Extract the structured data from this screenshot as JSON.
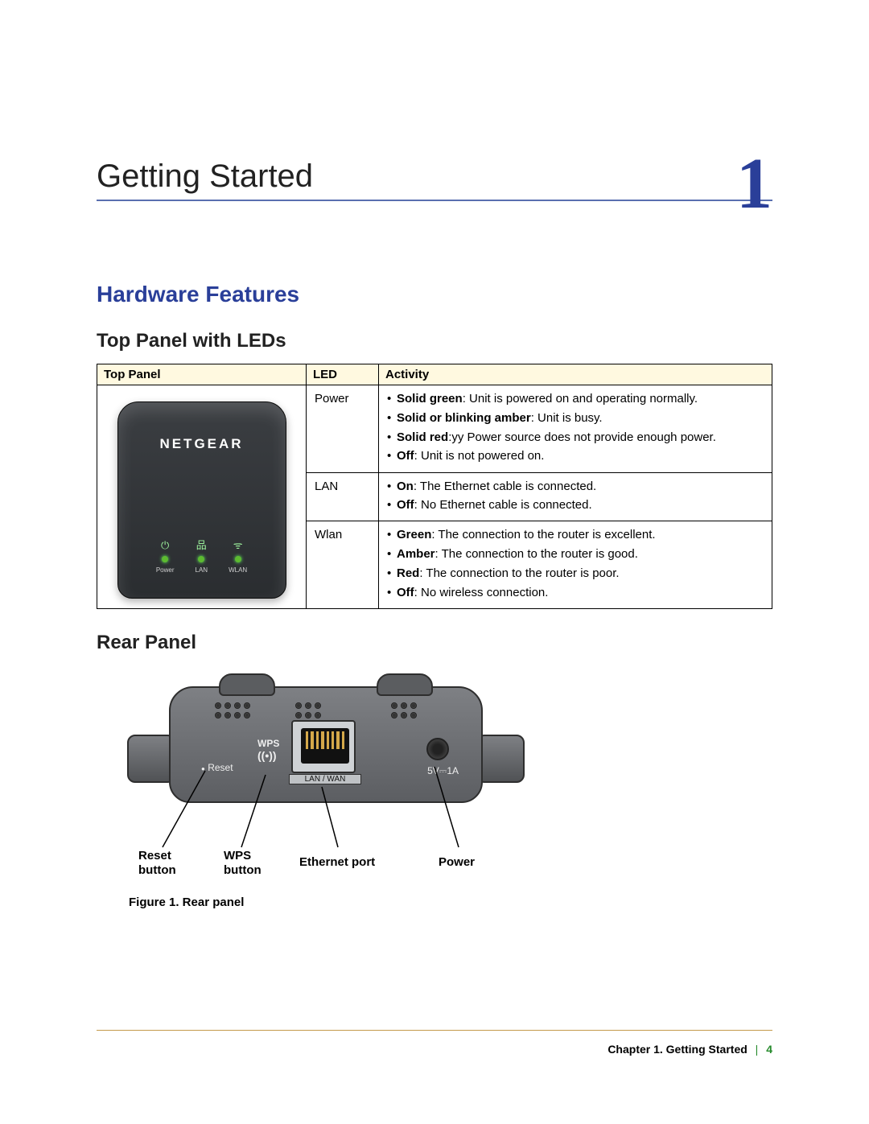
{
  "chapter": {
    "title": "Getting Started",
    "number": "1"
  },
  "section": "Hardware Features",
  "subsection_top": "Top Panel with LEDs",
  "subsection_rear": "Rear Panel",
  "table": {
    "headers": {
      "col1": "Top Panel",
      "col2": "LED",
      "col3": "Activity"
    },
    "brand": "NETGEAR",
    "led_labels": {
      "power": "Power",
      "lan": "LAN",
      "wlan": "WLAN"
    },
    "rows": [
      {
        "led": "Power",
        "items": [
          {
            "bold": "Solid green",
            "rest": ": Unit is powered on and operating normally."
          },
          {
            "bold": "Solid or blinking amber",
            "rest": ": Unit is busy."
          },
          {
            "bold": "Solid red",
            "rest": ":yy Power source does not provide enough power."
          },
          {
            "bold": "Off",
            "rest": ": Unit is not powered on."
          }
        ]
      },
      {
        "led": "LAN",
        "items": [
          {
            "bold": "On",
            "rest": ": The Ethernet cable is connected."
          },
          {
            "bold": "Off",
            "rest": ": No Ethernet cable is connected."
          }
        ]
      },
      {
        "led": "Wlan",
        "items": [
          {
            "bold": "Green",
            "rest": ": The connection to the router is excellent."
          },
          {
            "bold": "Amber",
            "rest": ": The connection to the router is good."
          },
          {
            "bold": "Red",
            "rest": ": The connection to the router is poor."
          },
          {
            "bold": "Off",
            "rest": ": No wireless connection."
          }
        ]
      }
    ]
  },
  "rear": {
    "wps": "WPS",
    "reset_lbl": "Reset",
    "power_lbl": "5V⎓1A",
    "eth_lbl": "LAN / WAN",
    "callouts": {
      "reset": "Reset\nbutton",
      "wps": "WPS\nbutton",
      "eth": "Ethernet port",
      "power": "Power"
    },
    "caption": "Figure 1. Rear panel"
  },
  "footer": {
    "chapter": "Chapter 1.  Getting Started",
    "page": "4"
  }
}
